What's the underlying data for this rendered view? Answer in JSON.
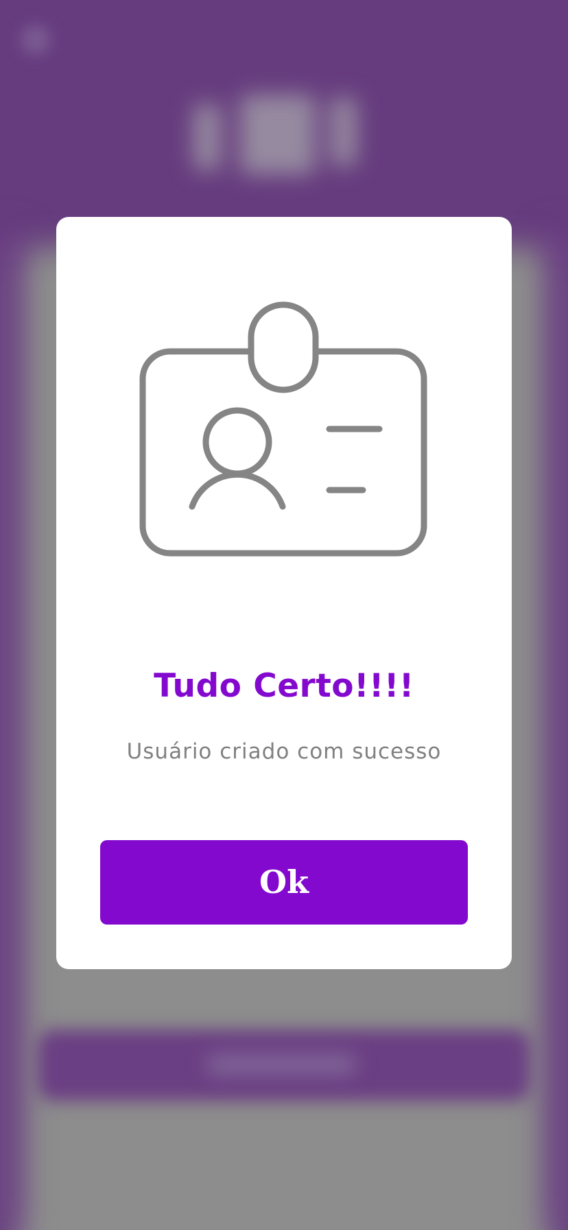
{
  "modal": {
    "icon": "id-card-icon",
    "title": "Tudo Certo!!!!",
    "message": "Usuário criado com sucesso",
    "ok_label": "Ok"
  },
  "colors": {
    "accent": "#8309cf",
    "icon_stroke": "#858585",
    "message_text": "#808080",
    "background_header": "#663c7e",
    "background_sheet": "#8d8d8d",
    "modal_background": "#ffffff"
  }
}
